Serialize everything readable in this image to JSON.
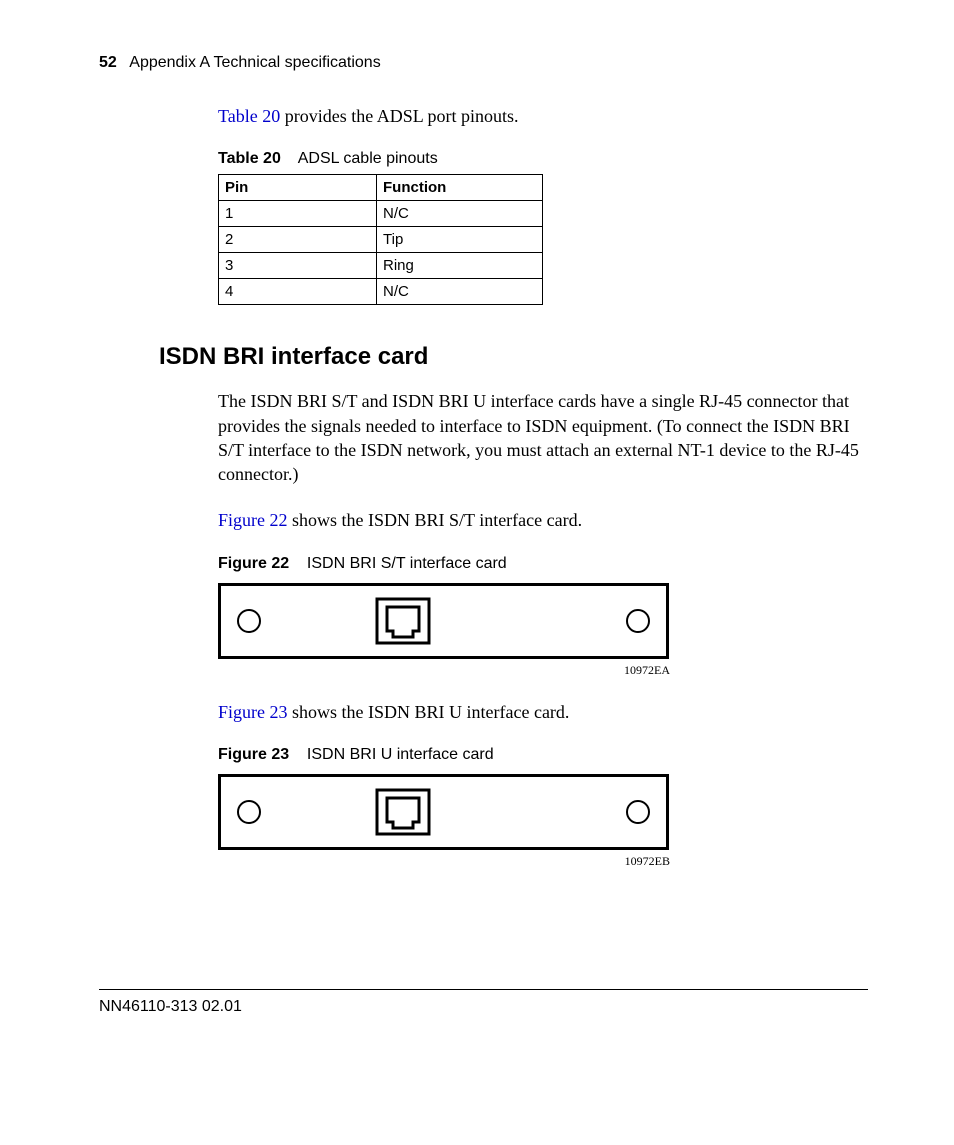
{
  "header": {
    "page_number": "52",
    "section": "Appendix A  Technical specifications"
  },
  "intro_para": {
    "link": "Table 20",
    "rest": " provides the ADSL port pinouts."
  },
  "table20": {
    "label": "Table 20",
    "title": "ADSL cable pinouts",
    "headers": {
      "pin": "Pin",
      "function": "Function"
    },
    "rows": [
      {
        "pin": "1",
        "function": "N/C"
      },
      {
        "pin": "2",
        "function": "Tip"
      },
      {
        "pin": "3",
        "function": "Ring"
      },
      {
        "pin": "4",
        "function": "N/C"
      }
    ]
  },
  "section_heading": "ISDN BRI interface card",
  "isdn_para": "The ISDN BRI S/T and ISDN BRI U interface cards have a single RJ-45 connector that provides the signals needed to interface to ISDN equipment. (To connect the ISDN BRI S/T interface to the ISDN network, you must attach an external NT-1 device to the RJ-45 connector.)",
  "fig22_intro": {
    "link": "Figure 22",
    "rest": " shows the ISDN BRI S/T interface card."
  },
  "figure22": {
    "label": "Figure 22",
    "title": "ISDN BRI S/T interface card",
    "id": "10972EA"
  },
  "fig23_intro": {
    "link": "Figure 23",
    "rest": " shows the ISDN BRI U interface card."
  },
  "figure23": {
    "label": "Figure 23",
    "title": "ISDN BRI U interface card",
    "id": "10972EB"
  },
  "footer": {
    "doc_id": "NN46110-313 02.01"
  }
}
